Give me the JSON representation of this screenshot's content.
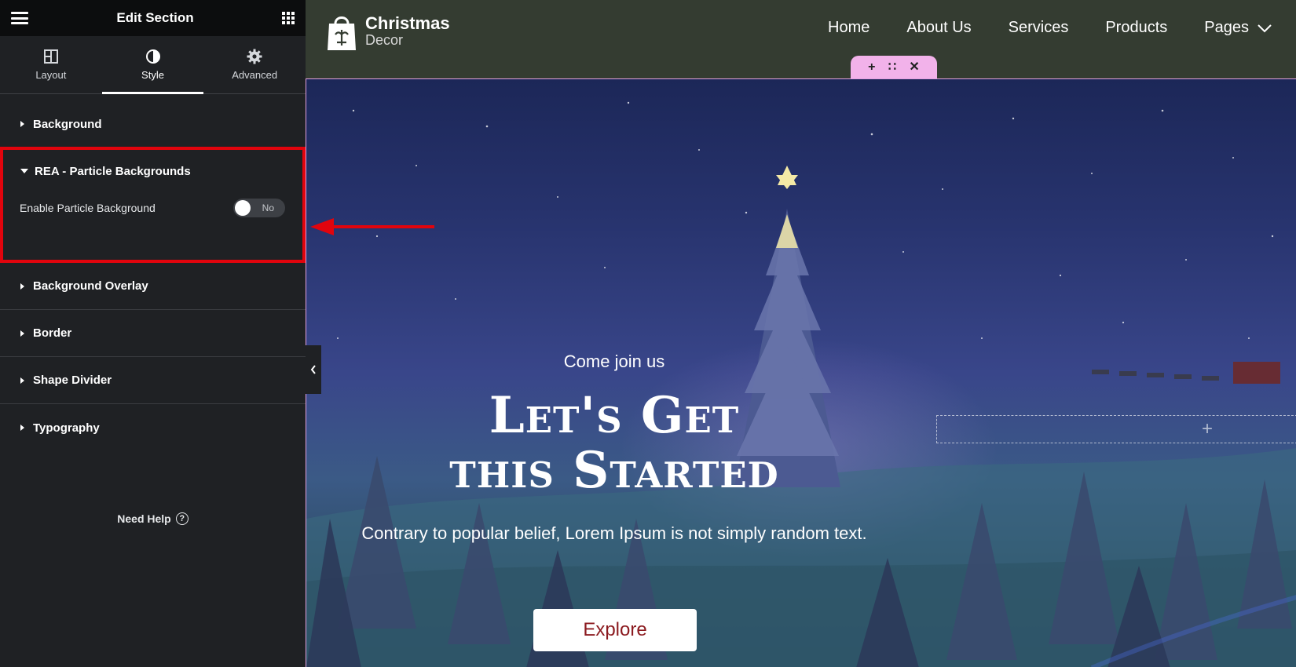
{
  "panel": {
    "title": "Edit Section",
    "tabs": [
      {
        "label": "Layout",
        "icon": "layout-icon"
      },
      {
        "label": "Style",
        "icon": "contrast-icon",
        "active": true
      },
      {
        "label": "Advanced",
        "icon": "gear-icon"
      }
    ],
    "sections": {
      "background": "Background",
      "rea_particle": "REA - Particle Backgrounds",
      "background_overlay": "Background Overlay",
      "border": "Border",
      "shape_divider": "Shape Divider",
      "typography": "Typography"
    },
    "particle": {
      "label": "Enable Particle Background",
      "toggle_text": "No",
      "enabled": false
    },
    "need_help": "Need Help",
    "highlight_color": "#e1040d"
  },
  "site": {
    "logo": {
      "name": "Christmas",
      "sub": "Decor"
    },
    "nav": [
      "Home",
      "About Us",
      "Services",
      "Products",
      "Pages"
    ],
    "hero": {
      "kicker": "Come join us",
      "title_line1": "Let's Get",
      "title_line2": "this Started",
      "description": "Contrary to popular belief, Lorem Ipsum is not simply random text.",
      "button": "Explore"
    }
  }
}
